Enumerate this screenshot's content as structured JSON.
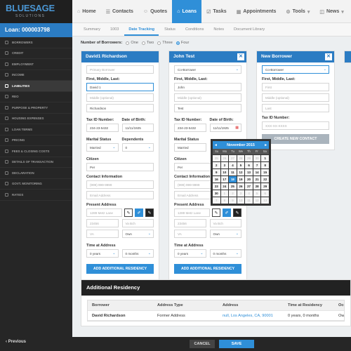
{
  "brand": {
    "name": "BLUESAGE",
    "tagline": "SOLUTIONS"
  },
  "nav": [
    {
      "label": "Home",
      "icon": "home-icon",
      "glyph": "⌂"
    },
    {
      "label": "Contacts",
      "icon": "contacts-icon",
      "glyph": "☰"
    },
    {
      "label": "Quotes",
      "icon": "quotes-icon",
      "glyph": "☺"
    },
    {
      "label": "Loans",
      "icon": "loans-icon",
      "glyph": "⌂"
    },
    {
      "label": "Tasks",
      "icon": "tasks-icon",
      "glyph": "☑"
    },
    {
      "label": "Appointments",
      "icon": "calendar-icon",
      "glyph": "▦"
    },
    {
      "label": "Tools",
      "icon": "tools-icon",
      "glyph": "⚙"
    },
    {
      "label": "News",
      "icon": "news-icon",
      "glyph": "◫"
    }
  ],
  "loan_number": "Loan: 000003798",
  "sidebar": [
    "BORROWERS",
    "CREDIT",
    "EMPLOYMENT",
    "INCOME",
    "LIABILITIES",
    "REO",
    "PURPOSE & PROPERTY",
    "HOUSING EXPENSES",
    "LOAN TERMS",
    "PRICING",
    "FEES & CLOSING COSTS",
    "DETAILS OF TRANSACTION",
    "DECLARATION",
    "GOVT. MONITORING",
    "RATIOS"
  ],
  "subtabs": [
    "Summary",
    "1003",
    "Date Tracking",
    "Status",
    "Conditions",
    "Notes",
    "Document Library"
  ],
  "borrowers": {
    "label": "Number of Borrowers:",
    "options": [
      "One",
      "Two",
      "Three",
      "Four"
    ]
  },
  "card1": {
    "title": "David1 Richardson",
    "role": "Primary Borrower",
    "name_label": "First, Middle, Last:",
    "first": "David 1",
    "middle_ph": "Middle (optional)",
    "last": "Richardson",
    "tax_label": "Tax ID Number:",
    "tax": "234-23-5432",
    "dob_label": "Date of Birth:",
    "dob": "11/11/1925",
    "marital_label": "Marital Status",
    "marital": "Married",
    "dependents_label": "Dependents",
    "dependents": "0",
    "citizen_label": "Citizen",
    "citizen": "Per",
    "contact_label": "Contact Information",
    "phone_ph": "(999) 999-9999",
    "email_ph": "Email Address",
    "address_label": "Present Address",
    "address": "1289 Metz Lane",
    "zip": "23456",
    "city": "Va Bch",
    "state": "VA",
    "own": "Own",
    "time_label": "Time at Address",
    "years": "0 years",
    "months": "0 months",
    "add_btn": "ADD ADDITIONAL RESIDENCY"
  },
  "card2": {
    "title": "John Test",
    "role": "Co-Borrower",
    "first": "John",
    "middle_ph": "Middle (optional)",
    "last": "Test",
    "tax": "234-23-5432",
    "dob": "11/11/1925",
    "marital": "Married",
    "citizen": "Per",
    "phone_ph": "(999) 999-9999",
    "email_ph": "Email Address",
    "address": "1289 Metz Lane",
    "zip": "23456",
    "city": "Va Bch",
    "state": "VA",
    "own": "Own",
    "years": "0 years",
    "months": "0 months",
    "add_btn": "ADD ADDITIONAL RESIDENCY"
  },
  "card3": {
    "title": "New Borrower",
    "role": "Co-Borrower",
    "first_ph": "First",
    "middle_ph": "Middle (optional)",
    "last_ph": "Last",
    "tax_ph": "XXX-XX-XXXX",
    "create_btn": "CREATE NEW CONTACT"
  },
  "calendar": {
    "month": "November 2015",
    "dow": [
      "Su",
      "Mo",
      "Tu",
      "We",
      "Th",
      "Fr",
      "Sa"
    ],
    "days": [
      [
        "25",
        "o"
      ],
      [
        "26",
        "o"
      ],
      [
        "27",
        "o"
      ],
      [
        "28",
        "o"
      ],
      [
        "29",
        "o"
      ],
      [
        "30",
        "o"
      ],
      [
        "1",
        ""
      ],
      [
        "2",
        ""
      ],
      [
        "3",
        ""
      ],
      [
        "4",
        ""
      ],
      [
        "5",
        ""
      ],
      [
        "6",
        ""
      ],
      [
        "7",
        ""
      ],
      [
        "8",
        ""
      ],
      [
        "9",
        ""
      ],
      [
        "10",
        ""
      ],
      [
        "11",
        ""
      ],
      [
        "12",
        ""
      ],
      [
        "13",
        ""
      ],
      [
        "14",
        ""
      ],
      [
        "15",
        ""
      ],
      [
        "16",
        ""
      ],
      [
        "17",
        ""
      ],
      [
        "18",
        "sel"
      ],
      [
        "19",
        ""
      ],
      [
        "20",
        ""
      ],
      [
        "21",
        ""
      ],
      [
        "22",
        ""
      ],
      [
        "23",
        ""
      ],
      [
        "24",
        ""
      ],
      [
        "25",
        ""
      ],
      [
        "26",
        ""
      ],
      [
        "27",
        ""
      ],
      [
        "28",
        ""
      ],
      [
        "29",
        ""
      ],
      [
        "30",
        ""
      ],
      [
        "1",
        "o"
      ],
      [
        "2",
        "o"
      ],
      [
        "3",
        "o"
      ],
      [
        "4",
        "o"
      ],
      [
        "5",
        "o"
      ],
      [
        "6",
        "o"
      ],
      [
        "7",
        "o"
      ],
      [
        "8",
        "o"
      ],
      [
        "9",
        "o"
      ],
      [
        "10",
        "o"
      ],
      [
        "11",
        "o"
      ],
      [
        "12",
        "o"
      ],
      [
        "13",
        "o"
      ]
    ]
  },
  "additional": {
    "title": "Additional Residency",
    "headers": [
      "Borrower",
      "Address Type",
      "Address",
      "Time at Residency",
      "Occupa..."
    ],
    "rows": [
      [
        "David Richardson",
        "Former Address",
        "null, Los Angeles, CA, 90001",
        "0 years, 0 months",
        "Own"
      ]
    ]
  },
  "footer": {
    "prev": "‹ Previous",
    "cancel": "CANCEL",
    "save": "SAVE"
  },
  "colors": {
    "accent": "#2f8fd8",
    "header_blue": "#2b7cc3",
    "dark": "#262626"
  }
}
